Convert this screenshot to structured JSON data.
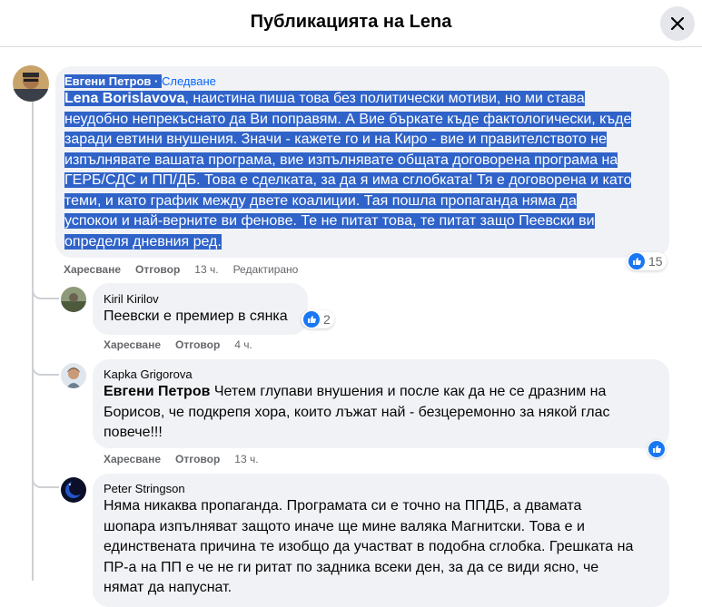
{
  "header": {
    "title": "Публикацията на Lena"
  },
  "comments": [
    {
      "author": "Евгени Петров",
      "separator": " · ",
      "follow_label": "Следване",
      "mention": "Lena Borislavova",
      "lines": [
        ", наистина пиша това без политически мотиви, но ми става",
        "неудобно непрекъснато да Ви поправям. А Вие бъркате къде фактологически, къде",
        "заради евтини внушения. Значи - кажете го и на Киро - вие и правителството не",
        "изпълнявате вашата програма, вие изпълнявате общата договорена програма на",
        "ГЕРБ/СДС и ПП/ДБ. Това е сделката, за да я има сглобката! Тя е договорена и като",
        "теми, и като график между двете коалиции. Тая пошла пропаганда няма да",
        "успокои и най-верните ви фенове. Те не питат това, те питат защо Пеевски ви",
        "определя дневния ред."
      ],
      "actions": {
        "like": "Харесване",
        "reply": "Отговор",
        "time": "13 ч.",
        "edited": "Редактирано"
      },
      "reactions": "15"
    },
    {
      "author": "Kiril Kirilov",
      "lines": [
        "Пеевски е премиер в сянка"
      ],
      "actions": {
        "like": "Харесване",
        "reply": "Отговор",
        "time": "4 ч."
      },
      "reactions": "2"
    },
    {
      "author": "Kapka Grigorova",
      "mention": "Евгени Петров",
      "lines": [
        " Четем глупави внушения и после как да не се дразним на",
        "Борисов, че подкрепя хора, които лъжат най - безцеремонно за някой глас",
        "повече!!!"
      ],
      "actions": {
        "like": "Харесване",
        "reply": "Отговор",
        "time": "13 ч."
      }
    },
    {
      "author": "Peter Stringson",
      "lines": [
        "Няма никаква пропаганда. Програмата си е точно на ППДБ, а двамата",
        "шопара изпълняват защото иначе ще мине валяка Магнитски. Това е и",
        "единствената причина те изобщо да участват в подобна сглобка. Грешката на",
        "ПР-а на ПП е че не ги ритат по задника всеки ден, за да се види ясно, че",
        "нямат да напуснат."
      ]
    }
  ],
  "colors": {
    "selection": "#2f63c9",
    "bubble": "#f0f2f5",
    "link": "#0866ff",
    "like": "#1877f2"
  },
  "icons": [
    "close-icon",
    "like-icon",
    "avatar"
  ]
}
